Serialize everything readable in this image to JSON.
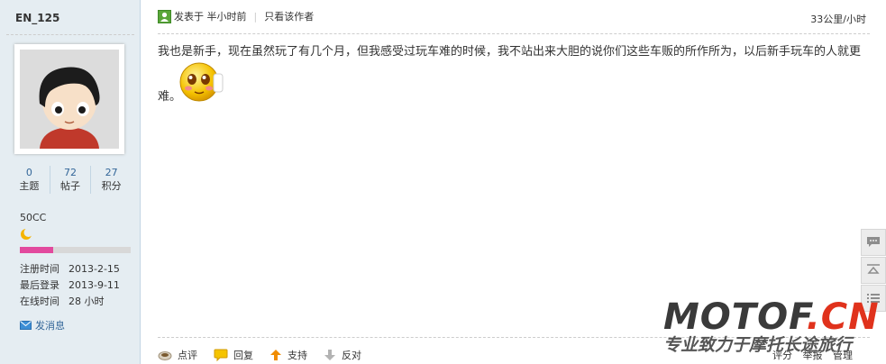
{
  "author": {
    "username": "EN_125",
    "stats": [
      {
        "value": "0",
        "label": "主题"
      },
      {
        "value": "72",
        "label": "帖子"
      },
      {
        "value": "27",
        "label": "积分"
      }
    ],
    "rank": "50CC",
    "level_progress_percent": 30,
    "info": [
      {
        "key": "注册时间",
        "value": "2013-2-15"
      },
      {
        "key": "最后登录",
        "value": "2013-9-11"
      },
      {
        "key": "在线时间",
        "value": "28 小时"
      }
    ],
    "send_message": "发消息"
  },
  "post": {
    "posted_time": "发表于 半小时前",
    "author_only": "只看该作者",
    "speed": "33公里/小时",
    "body_line1": "我也是新手，现在虽然玩了有几个月，但我感受过玩车难的时候，我不站出来大胆的说你们这些车贩的所作所为，以后新手玩车的人就更",
    "body_line2": "难。"
  },
  "actions": [
    {
      "label": "点评",
      "icon": "comment-icon"
    },
    {
      "label": "回复",
      "icon": "reply-icon"
    },
    {
      "label": "支持",
      "icon": "arrow-up-icon"
    },
    {
      "label": "反对",
      "icon": "arrow-down-icon"
    }
  ],
  "management": {
    "rate": "评分",
    "report": "举报",
    "manage": "管理"
  },
  "watermark": {
    "logo_main": "MOTOF",
    "logo_domain": ".CN",
    "tagline": "专业致力于摩托长途旅行"
  },
  "colors": {
    "sidebar_bg": "#e5edf2",
    "link": "#336699",
    "progress": "#e24a9e",
    "logo_red": "#e0321c"
  }
}
